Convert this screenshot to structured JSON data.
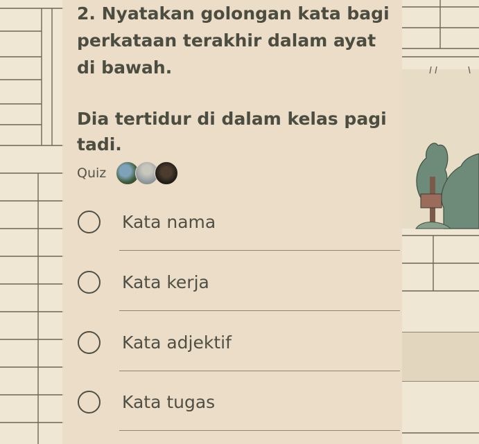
{
  "question": {
    "lines": [
      "2. Nyatakan golongan kata bagi",
      "perkataan terakhir dalam ayat",
      "di bawah."
    ],
    "sentence": [
      "Dia tertidur di dalam kelas pagi",
      "tadi."
    ]
  },
  "quiz": {
    "label": "Quiz",
    "avatars": [
      "avatar-1",
      "avatar-2",
      "avatar-3"
    ]
  },
  "options": [
    {
      "label": "Kata nama"
    },
    {
      "label": "Kata kerja"
    },
    {
      "label": "Kata adjektif"
    },
    {
      "label": "Kata tugas"
    }
  ],
  "colors": {
    "text": "#4c4c40",
    "card": "#eadcc6",
    "background": "#efe6d4",
    "tree": "#6e8a78"
  }
}
